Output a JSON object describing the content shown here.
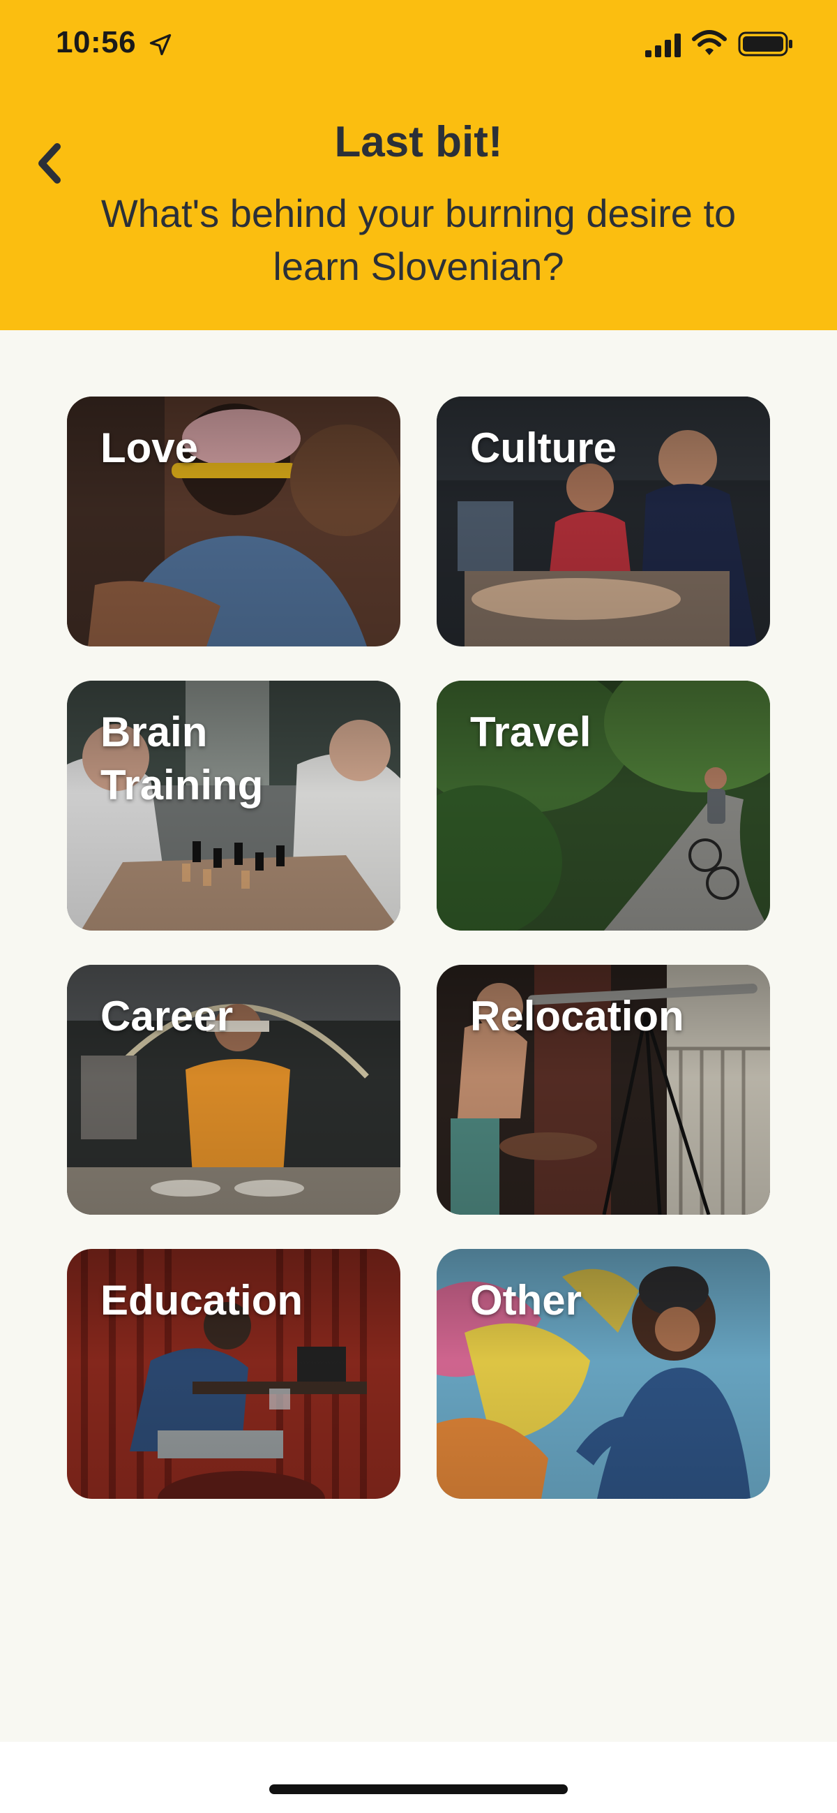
{
  "status_bar": {
    "time": "10:56",
    "icons": [
      "location-arrow-icon",
      "signal-icon",
      "wifi-icon",
      "battery-icon"
    ]
  },
  "header": {
    "background": "#fbbe10",
    "back_icon": "chevron-left-icon",
    "title": "Last bit!",
    "subtitle": "What's behind your burning desire to learn Slovenian?"
  },
  "options": [
    {
      "label": "Love",
      "image": "couple hugging"
    },
    {
      "label": "Culture",
      "image": "street food market"
    },
    {
      "label": "Brain Training",
      "image": "men playing chess"
    },
    {
      "label": "Travel",
      "image": "cyclists in jungle"
    },
    {
      "label": "Career",
      "image": "chef stretching noodles"
    },
    {
      "label": "Relocation",
      "image": "child at telescope"
    },
    {
      "label": "Education",
      "image": "man studying in cafe"
    },
    {
      "label": "Other",
      "image": "woman by graffiti wall"
    }
  ]
}
